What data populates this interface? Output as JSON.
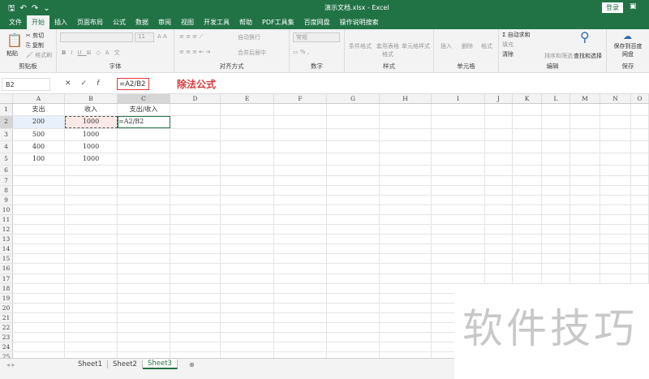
{
  "title": {
    "filename": "演示文档.xlsx - Excel",
    "login": "登录"
  },
  "tabs": [
    "文件",
    "开始",
    "插入",
    "页面布局",
    "公式",
    "数据",
    "审阅",
    "视图",
    "开发工具",
    "帮助",
    "PDF工具集",
    "百度网盘"
  ],
  "active_tab": "开始",
  "tell_me": "操作说明搜索",
  "ribbon": {
    "clipboard": {
      "label": "剪贴板",
      "paste": "粘贴",
      "cut": "剪切",
      "copy": "复制",
      "format_painter": "格式刷"
    },
    "font": {
      "label": "字体",
      "size": "11",
      "bold": "B",
      "italic": "I",
      "underline": "U"
    },
    "alignment": {
      "label": "对齐方式",
      "wrap": "自动换行",
      "merge": "合并后居中"
    },
    "number": {
      "label": "数字",
      "format": "常规"
    },
    "styles": {
      "label": "样式",
      "conditional": "条件格式",
      "table": "套用表格格式",
      "cell": "单元格样式"
    },
    "cells": {
      "label": "单元格",
      "insert": "插入",
      "delete": "删除",
      "format": "格式"
    },
    "editing": {
      "label": "编辑",
      "autosum": "自动求和",
      "fill": "填充",
      "clear": "清除",
      "sort": "排序和筛选",
      "find": "查找和选择"
    },
    "save": {
      "label": "保存",
      "save_to": "保存到百度网盘"
    }
  },
  "formula_bar": {
    "name_box": "B2",
    "formula": "=A2/B2",
    "annotation": "除法公式"
  },
  "columns": [
    "A",
    "B",
    "C",
    "D",
    "E",
    "F",
    "G",
    "H",
    "I",
    "J",
    "K",
    "L",
    "M",
    "N",
    "O"
  ],
  "rows": [
    [
      "支出",
      "收入",
      "支出/收入"
    ],
    [
      "200",
      "1000",
      "=A2/B2"
    ],
    [
      "500",
      "1000",
      ""
    ],
    [
      "400",
      "1000",
      ""
    ],
    [
      "100",
      "1000",
      ""
    ]
  ],
  "row_count": 25,
  "sheets": [
    "Sheet1",
    "Sheet2",
    "Sheet3"
  ],
  "active_sheet": "Sheet3",
  "watermark": "软件技巧",
  "colors": {
    "accent": "#217346",
    "annotation": "#d9383a"
  }
}
